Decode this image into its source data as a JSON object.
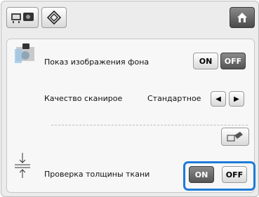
{
  "toolbar": {
    "home_icon": "home-icon"
  },
  "background_display": {
    "label": "Показ изображения фона",
    "on": "ON",
    "off": "OFF",
    "selected": "OFF"
  },
  "scan_quality": {
    "label": "Качество сканирое",
    "value": "Стандартное"
  },
  "thickness_check": {
    "label": "Проверка толщины ткани",
    "on": "ON",
    "off": "OFF",
    "selected": "ON"
  },
  "colors": {
    "highlight": "#1e7bd7"
  }
}
